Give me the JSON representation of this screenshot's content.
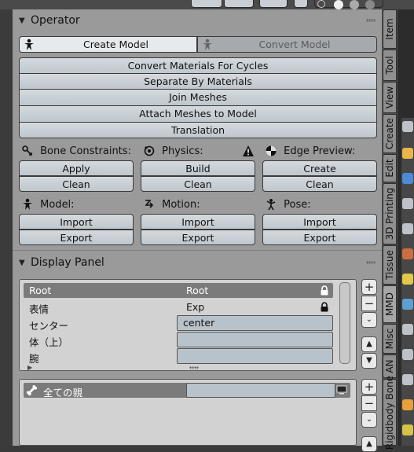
{
  "operator": {
    "title": "Operator",
    "create_model": "Create Model",
    "convert_model": "Convert Model",
    "convert_materials": "Convert Materials For Cycles",
    "separate_materials": "Separate By Materials",
    "join_meshes": "Join Meshes",
    "attach_meshes": "Attach Meshes to Model",
    "translation": "Translation",
    "bone_constraints": {
      "label": "Bone Constraints:",
      "top": "Apply",
      "bottom": "Clean"
    },
    "physics": {
      "label": "Physics:",
      "top": "Build",
      "bottom": "Clean"
    },
    "edge_preview": {
      "label": "Edge Preview:",
      "top": "Create",
      "bottom": "Clean"
    },
    "model": {
      "label": "Model:",
      "top": "Import",
      "bottom": "Export"
    },
    "motion": {
      "label": "Motion:",
      "top": "Import",
      "bottom": "Export"
    },
    "pose": {
      "label": "Pose:",
      "top": "Import",
      "bottom": "Export"
    }
  },
  "display_panel": {
    "title": "Display Panel",
    "frames": [
      {
        "name": "Root",
        "value": "Root"
      },
      {
        "name": "表情",
        "value": "Exp"
      },
      {
        "name": "センター",
        "value": "center"
      },
      {
        "name": "体（上）",
        "value": ""
      },
      {
        "name": "腕",
        "value": ""
      }
    ],
    "bone_item": "全ての親",
    "bone_value": "",
    "plus": "+",
    "minus": "−"
  },
  "tabs": [
    "Item",
    "Tool",
    "View",
    "Create",
    "Edit",
    "3D Printing",
    "Tissue",
    "MMD",
    "Misc",
    "AN",
    "Rigidbody Bone"
  ],
  "active_tab": "MMD",
  "colors": {
    "panel": "#9a9a9a",
    "button": "#c9d1d7",
    "selected_row": "#7b7b7b",
    "field": "#b8c2ca"
  }
}
